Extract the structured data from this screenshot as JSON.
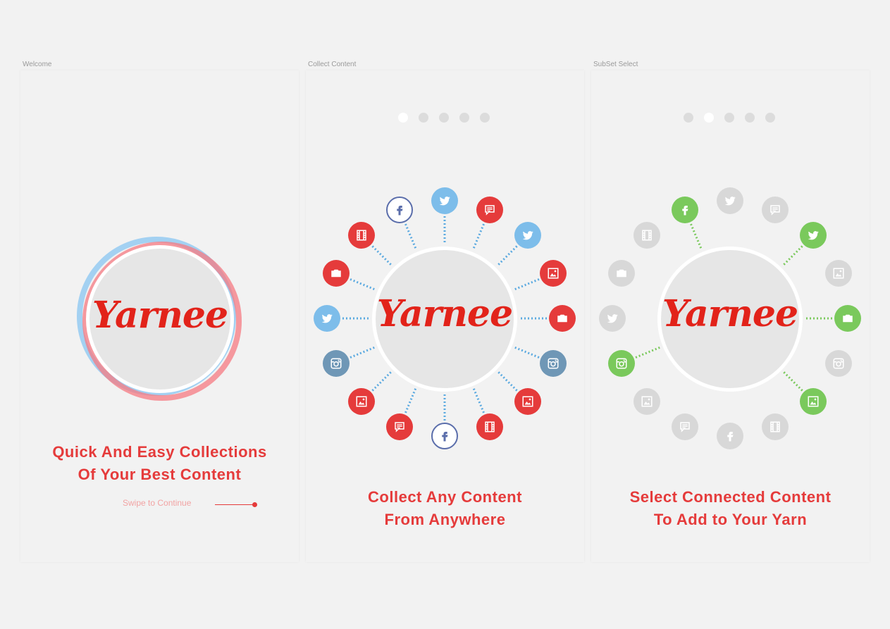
{
  "screens": [
    {
      "label": "Welcome",
      "logo": "Yarnee",
      "headline_line1": "Quick And Easy Collections",
      "headline_line2": "Of Your Best Content",
      "swipe": "Swipe to Continue"
    },
    {
      "label": "Collect Content",
      "logo": "Yarnee",
      "active_dot": 1,
      "dots": 5,
      "headline_line1": "Collect Any Content",
      "headline_line2": "From Anywhere"
    },
    {
      "label": "SubSet Select",
      "logo": "Yarnee",
      "active_dot": 2,
      "dots": 5,
      "headline_line1": "Select Connected Content",
      "headline_line2": "To Add to Your Yarn"
    }
  ],
  "colors": {
    "red": "#e53b3b",
    "twitter": "#7dbdea",
    "facebook": "#5b6eab",
    "instagram": "#6f97b6",
    "selected": "#7ac95c",
    "unselected": "#d8d8d8",
    "dotted_blue": "#5aa9e0",
    "dotted_green": "#7ac95c"
  },
  "orbit_icons": [
    {
      "type": "twitter-icon"
    },
    {
      "type": "message-icon"
    },
    {
      "type": "twitter-icon"
    },
    {
      "type": "photo-icon"
    },
    {
      "type": "camera-icon"
    },
    {
      "type": "instagram-icon"
    },
    {
      "type": "photo-icon"
    },
    {
      "type": "film-icon"
    },
    {
      "type": "facebook-icon"
    },
    {
      "type": "message-icon"
    },
    {
      "type": "photo-icon"
    },
    {
      "type": "instagram-icon"
    },
    {
      "type": "twitter-icon"
    },
    {
      "type": "camera-icon"
    },
    {
      "type": "film-icon"
    },
    {
      "type": "facebook-icon"
    }
  ],
  "selected_icons": [
    "facebook-icon-0",
    "twitter-icon-2",
    "camera-icon-4",
    "photo-icon-6",
    "instagram-icon-11"
  ]
}
